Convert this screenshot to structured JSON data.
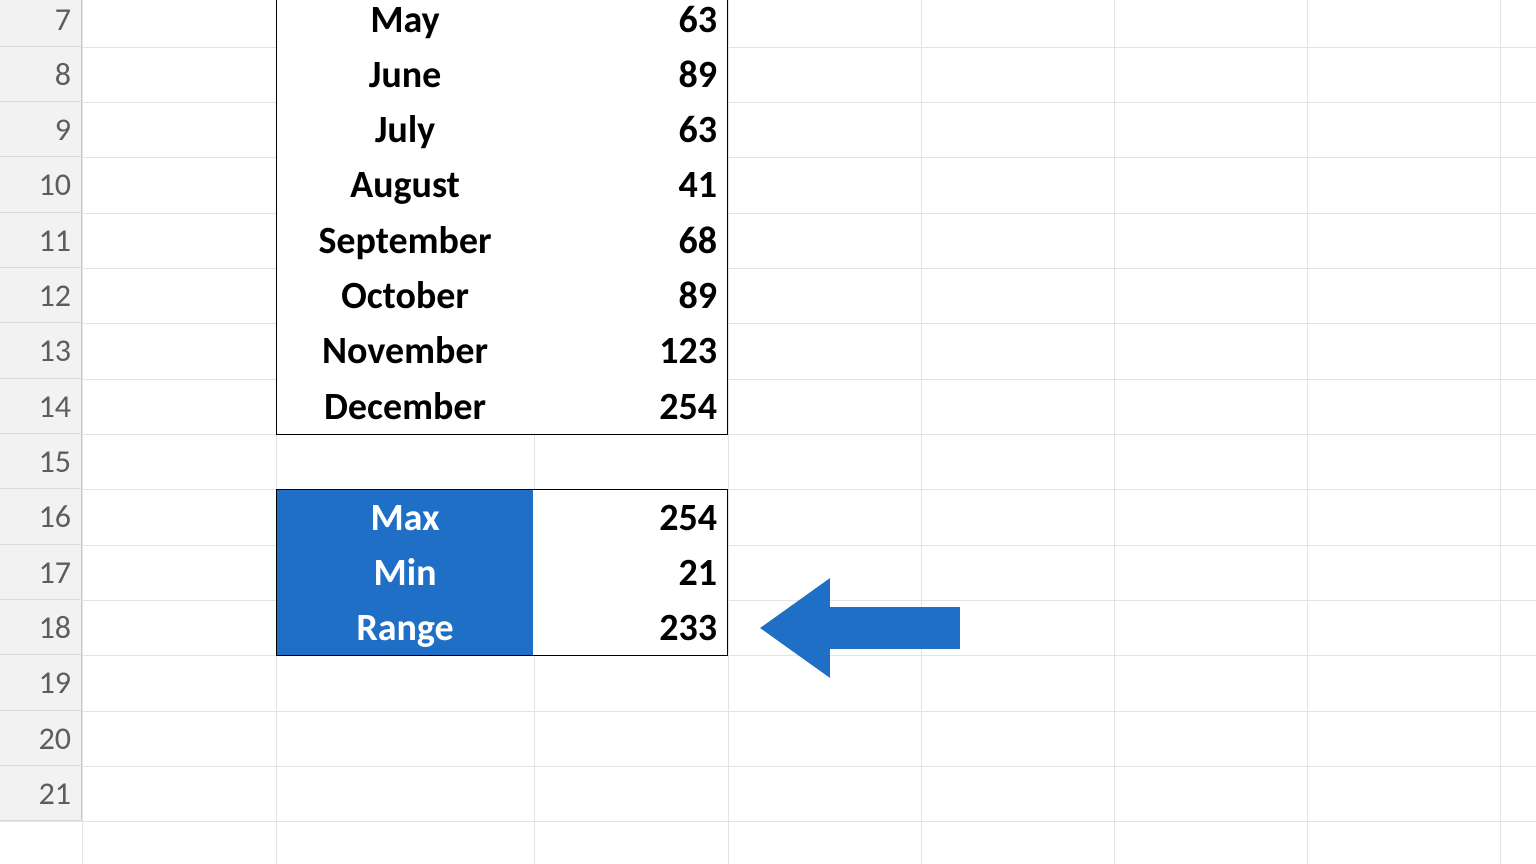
{
  "row_headers": [
    "7",
    "8",
    "9",
    "10",
    "11",
    "12",
    "13",
    "14",
    "15",
    "16",
    "17",
    "18",
    "19",
    "20",
    "21"
  ],
  "months": {
    "r7": {
      "label": "May",
      "value": "63"
    },
    "r8": {
      "label": "June",
      "value": "89"
    },
    "r9": {
      "label": "July",
      "value": "63"
    },
    "r10": {
      "label": "August",
      "value": "41"
    },
    "r11": {
      "label": "September",
      "value": "68"
    },
    "r12": {
      "label": "October",
      "value": "89"
    },
    "r13": {
      "label": "November",
      "value": "123"
    },
    "r14": {
      "label": "December",
      "value": "254"
    }
  },
  "stats": {
    "max": {
      "label": "Max",
      "value": "254"
    },
    "min": {
      "label": "Min",
      "value": "21"
    },
    "range": {
      "label": "Range",
      "value": "233"
    }
  },
  "chart_data": {
    "type": "table",
    "categories": [
      "May",
      "June",
      "July",
      "August",
      "September",
      "October",
      "November",
      "December"
    ],
    "values": [
      63,
      89,
      63,
      41,
      68,
      89,
      123,
      254
    ],
    "summary": {
      "Max": 254,
      "Min": 21,
      "Range": 233
    }
  }
}
